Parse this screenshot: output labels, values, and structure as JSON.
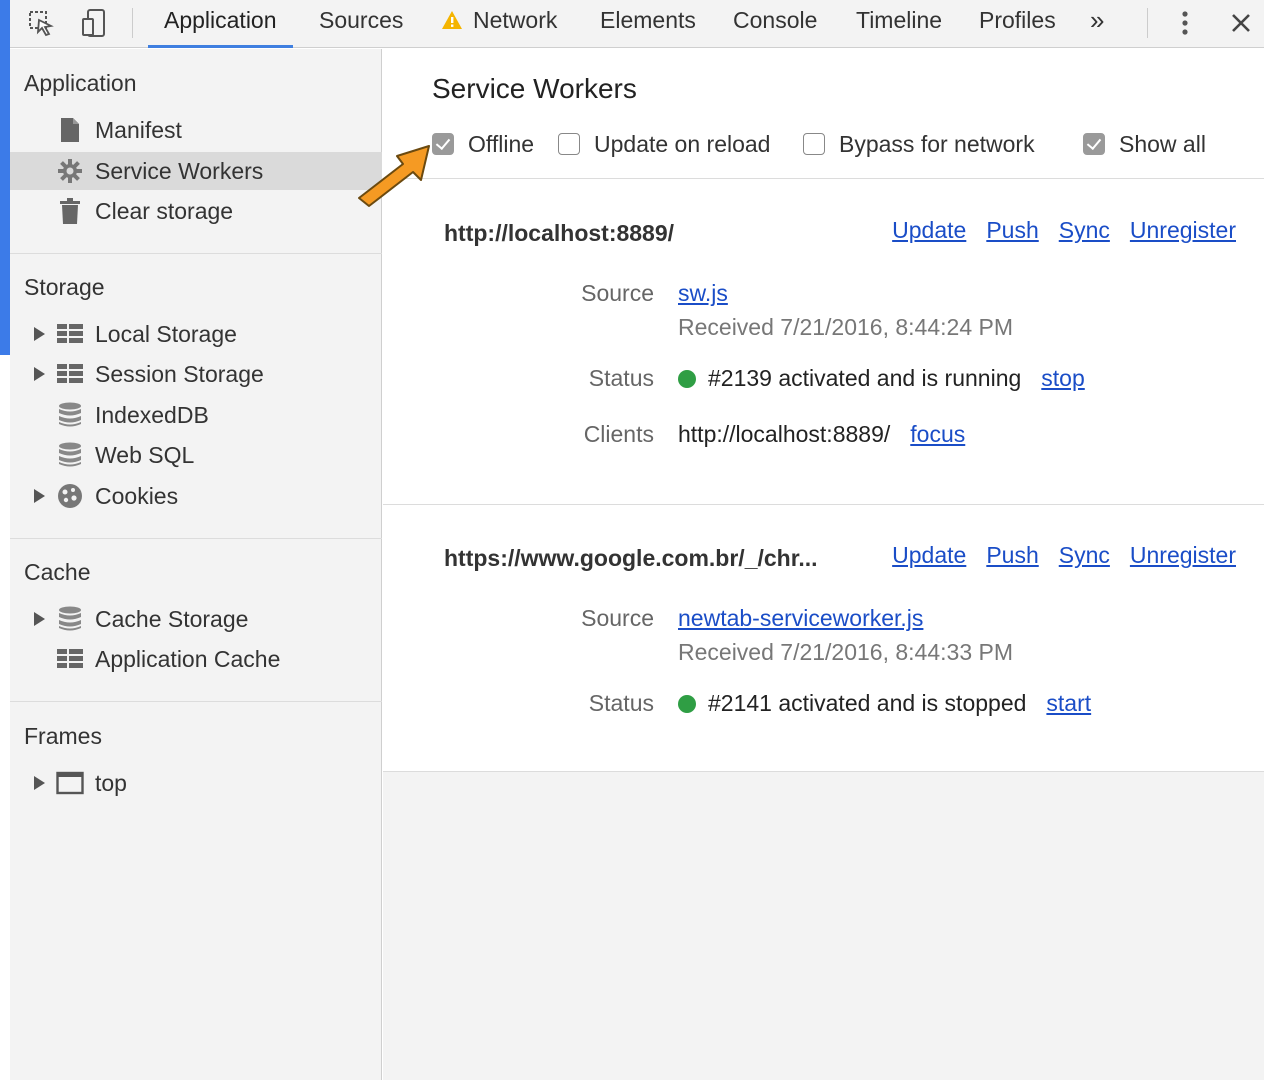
{
  "tabs": [
    {
      "label": "Application",
      "active": true
    },
    {
      "label": "Sources"
    },
    {
      "label": "Network",
      "warning": true
    },
    {
      "label": "Elements"
    },
    {
      "label": "Console"
    },
    {
      "label": "Timeline"
    },
    {
      "label": "Profiles"
    }
  ],
  "overflow_label": "»",
  "icons": [
    "inspect-icon",
    "device-icon",
    "warning-icon",
    "more-vert-icon",
    "close-icon"
  ],
  "sidebar": {
    "application": {
      "title": "Application",
      "items": [
        {
          "label": "Manifest",
          "icon": "document-icon"
        },
        {
          "label": "Service Workers",
          "icon": "gear-icon",
          "selected": true
        },
        {
          "label": "Clear storage",
          "icon": "trash-icon"
        }
      ]
    },
    "storage": {
      "title": "Storage",
      "items": [
        {
          "label": "Local Storage",
          "icon": "grid-icon",
          "expandable": true
        },
        {
          "label": "Session Storage",
          "icon": "grid-icon",
          "expandable": true
        },
        {
          "label": "IndexedDB",
          "icon": "database-icon"
        },
        {
          "label": "Web SQL",
          "icon": "database-icon"
        },
        {
          "label": "Cookies",
          "icon": "cookie-icon",
          "expandable": true
        }
      ]
    },
    "cache": {
      "title": "Cache",
      "items": [
        {
          "label": "Cache Storage",
          "icon": "database-icon",
          "expandable": true
        },
        {
          "label": "Application Cache",
          "icon": "grid-icon"
        }
      ]
    },
    "frames": {
      "title": "Frames",
      "items": [
        {
          "label": "top",
          "icon": "frame-icon",
          "expandable": true
        }
      ]
    }
  },
  "main": {
    "title": "Service Workers",
    "options": [
      {
        "label": "Offline",
        "checked": true
      },
      {
        "label": "Update on reload",
        "checked": false
      },
      {
        "label": "Bypass for network",
        "checked": false
      },
      {
        "label": "Show all",
        "checked": true
      }
    ],
    "workers": [
      {
        "scope": "http://localhost:8889/",
        "actions": [
          "Update",
          "Push",
          "Sync",
          "Unregister"
        ],
        "source_label": "Source",
        "source": "sw.js",
        "received": "Received 7/21/2016, 8:44:24 PM",
        "status_label": "Status",
        "status": "#2139 activated and is running",
        "status_action": "stop",
        "clients_label": "Clients",
        "clients": "http://localhost:8889/",
        "clients_action": "focus"
      },
      {
        "scope": "https://www.google.com.br/_/chr...",
        "actions": [
          "Update",
          "Push",
          "Sync",
          "Unregister"
        ],
        "source_label": "Source",
        "source": "newtab-serviceworker.js",
        "received": "Received 7/21/2016, 8:44:33 PM",
        "status_label": "Status",
        "status": "#2141 activated and is stopped",
        "status_action": "start"
      }
    ]
  },
  "colors": {
    "accent": "#3c7be8",
    "link": "#1a4dc7",
    "status_green": "#2f9e44",
    "annotation_arrow": "#f59a23"
  }
}
